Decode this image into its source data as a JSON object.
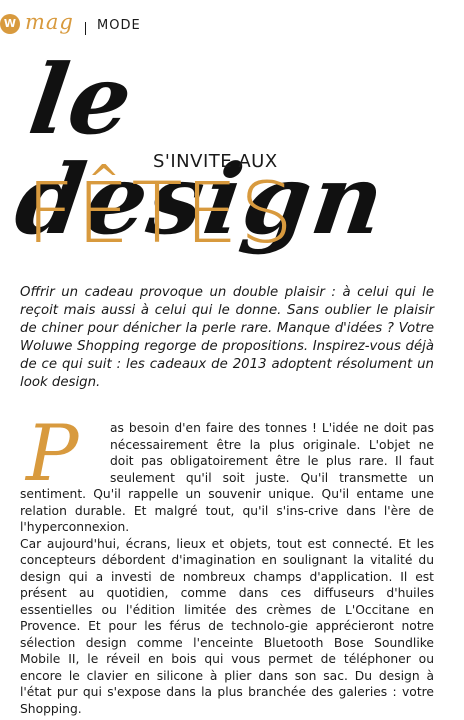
{
  "header": {
    "badge": "W",
    "mag": "mag",
    "section": "MODE"
  },
  "title": {
    "script": "le design",
    "subtitle": "S'INVITE AUX",
    "main": "FÊTES"
  },
  "lead": "Offrir un cadeau provoque un double plaisir : à celui qui le reçoit mais aussi à celui qui le donne. Sans oublier le plaisir de chiner pour dénicher la perle rare. Manque d'idées ? Votre Woluwe Shopping regorge de propositions. Inspirez-vous déjà de ce qui suit : les cadeaux de 2013 adoptent résolument un look design.",
  "article": {
    "dropcap": "P",
    "p1": "as besoin d'en faire des tonnes ! L'idée ne doit pas nécessairement être la plus originale. L'objet ne doit pas obligatoirement être le plus rare. Il faut seulement qu'il soit juste. Qu'il transmette un sentiment. Qu'il rappelle un souvenir unique. Qu'il entame une relation durable. Et malgré tout, qu'il s'ins-crive dans l'ère de l'hyperconnexion.",
    "p2": "Car aujourd'hui, écrans, lieux et objets, tout est connecté. Et les concepteurs débordent d'imagination en soulignant la vitalité du design qui a investi de nombreux champs d'application. Il est présent au quotidien, comme dans ces diffuseurs d'huiles essentielles ou l'édition limitée des crèmes de L'Occitane en Provence. Et pour les férus de technolo-gie apprécieront notre sélection design comme l'enceinte Bluetooth Bose Soundlike Mobile II, le réveil en bois qui vous permet de téléphoner ou encore le clavier en silicone à plier dans son sac. Du design à l'état pur qui s'expose dans la plus branchée des galeries : votre Shopping."
  },
  "colors": {
    "accent": "#d89a3e",
    "text": "#1a1a1a"
  }
}
